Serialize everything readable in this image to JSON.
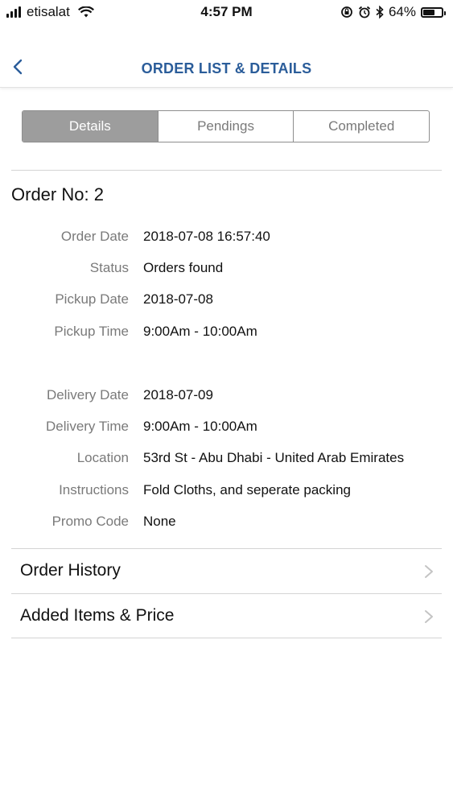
{
  "status_bar": {
    "carrier": "etisalat",
    "time": "4:57 PM",
    "battery": "64%",
    "battery_level": 0.64
  },
  "header": {
    "title": "ORDER LIST & DETAILS",
    "back_icon": "chevron-left-icon",
    "accent_color": "#2b5d9a"
  },
  "tabs": [
    {
      "label": "Details",
      "active": true
    },
    {
      "label": "Pendings",
      "active": false
    },
    {
      "label": "Completed",
      "active": false
    }
  ],
  "order": {
    "title": "Order No: 2",
    "details": [
      {
        "label": "Order Date",
        "value": "2018-07-08 16:57:40"
      },
      {
        "label": "Status",
        "value": "Orders found"
      },
      {
        "label": "Pickup Date",
        "value": "2018-07-08"
      },
      {
        "label": "Pickup Time",
        "value": "9:00Am - 10:00Am"
      },
      {
        "label": "Delivery Date",
        "value": "2018-07-09"
      },
      {
        "label": "Delivery Time",
        "value": "9:00Am - 10:00Am"
      },
      {
        "label": "Location",
        "value": "53rd St - Abu Dhabi - United Arab Emirates"
      },
      {
        "label": "Instructions",
        "value": "Fold Cloths, and seperate packing"
      },
      {
        "label": "Promo Code",
        "value": "None"
      }
    ]
  },
  "links": [
    {
      "label": "Order History",
      "icon": "chevron-right-icon"
    },
    {
      "label": "Added Items & Price",
      "icon": "chevron-right-icon"
    }
  ]
}
